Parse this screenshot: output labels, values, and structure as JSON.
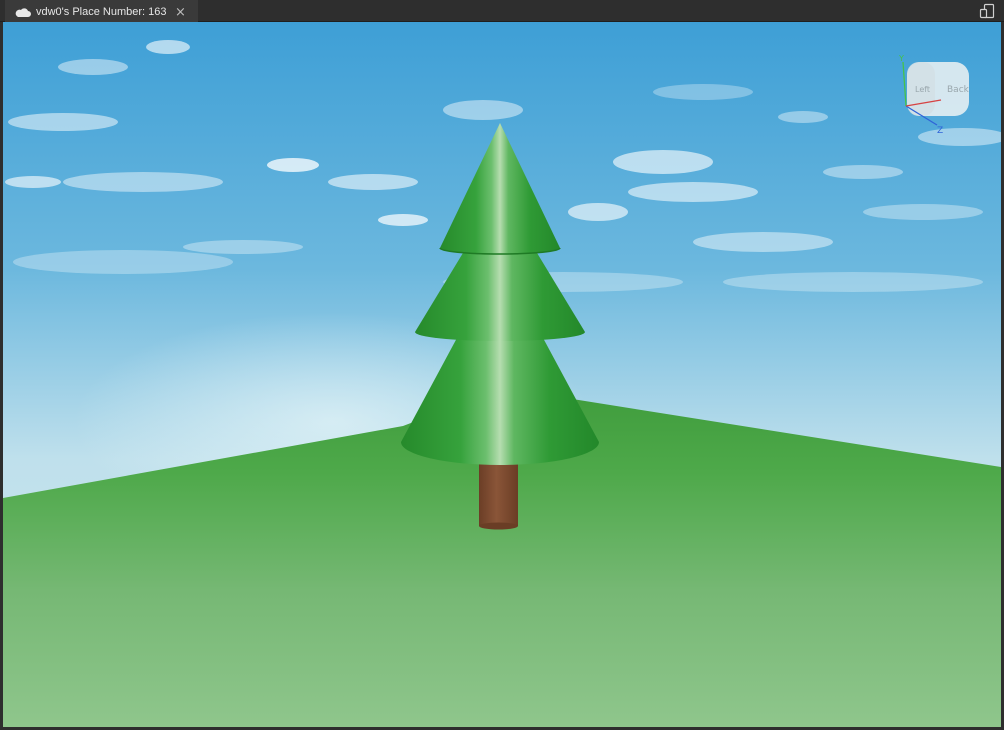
{
  "tab": {
    "title": "vdw0's Place Number: 163",
    "close_glyph": "×",
    "icon": "cloud-icon"
  },
  "toolbar": {
    "device_icon": "device-emulator-icon"
  },
  "view_cube": {
    "left_label": "Left",
    "back_label": "Back",
    "axis_y": "Y",
    "axis_z": "Z",
    "axis_x": "X"
  },
  "colors": {
    "sky_top": "#3e9fd6",
    "sky_horizon": "#bfe0ec",
    "ground_near": "#8dc48a",
    "ground_far": "#3f9c3c",
    "foliage": "#2e9a35",
    "trunk": "#7a4a2e",
    "chrome": "#2e2e2e"
  }
}
